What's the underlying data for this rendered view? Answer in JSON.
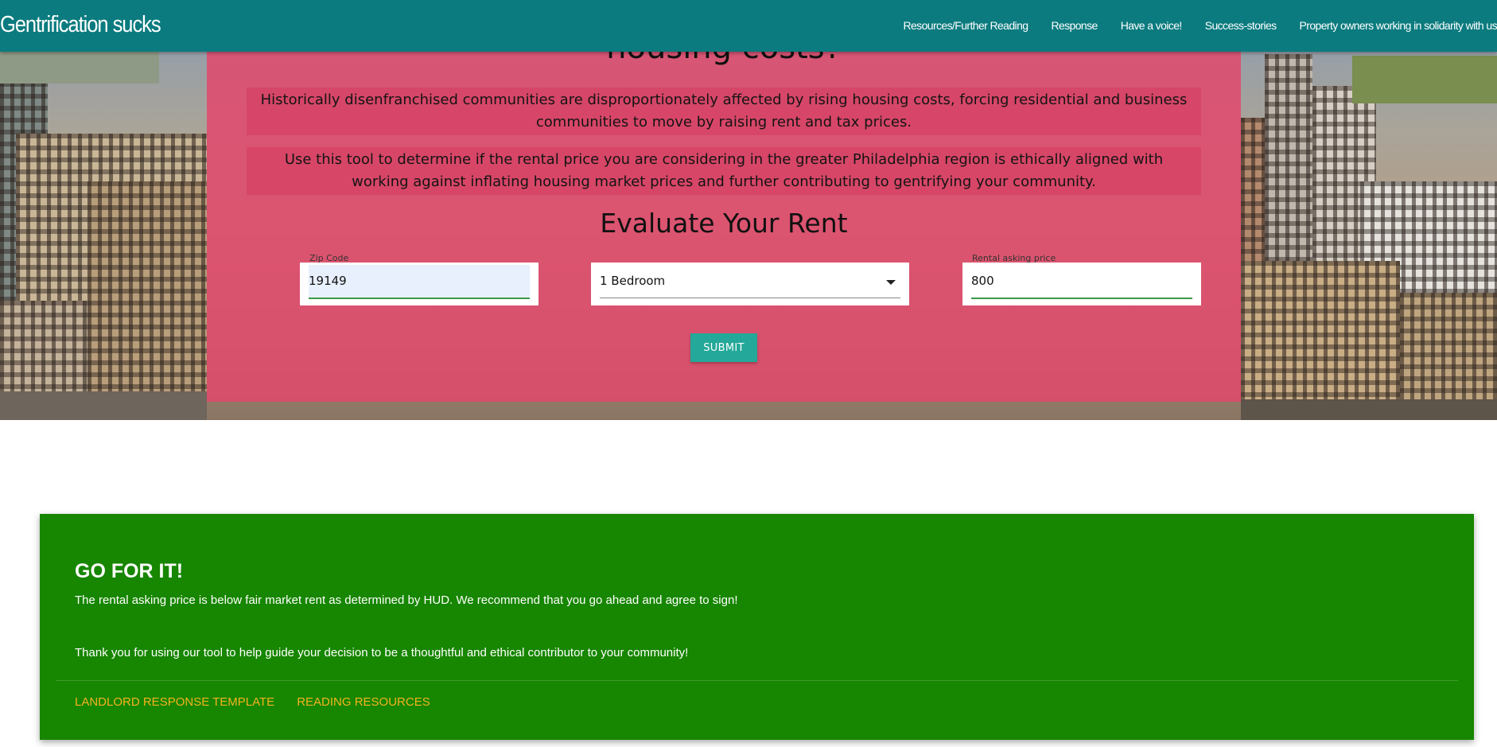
{
  "navbar": {
    "brand": "Gentrification sucks",
    "links": [
      "Resources/Further Reading",
      "Response",
      "Have a voice!",
      "Success-stories",
      "Property owners working in solidarity with us"
    ]
  },
  "hero": {
    "partial_title": "housing costs?",
    "description_1": "Historically disenfranchised communities are disproportionately affected by rising housing costs, forcing residential and business communities to move by raising rent and tax prices.",
    "description_2": "Use this tool to determine if the rental price you are considering in the greater Philadelphia region is ethically aligned with working against inflating housing market prices and further contributing to gentrifying your community.",
    "form_title": "Evaluate Your Rent",
    "zip_label": "Zip Code",
    "zip_value": "19149",
    "bedroom_value": "1 Bedroom",
    "price_label": "Rental asking price",
    "price_value": "800",
    "submit_label": "SUBMIT"
  },
  "result": {
    "title": "GO FOR IT!",
    "message": "The rental asking price is below fair market rent as determined by HUD. We recommend that you go ahead and agree to sign!",
    "thanks": "Thank you for using our tool to help guide your decision to be a thoughtful and ethical contributor to your community!",
    "links": [
      "LANDLORD RESPONSE TEMPLATE",
      "READING RESOURCES"
    ]
  },
  "colors": {
    "navbar": "#0b7b7f",
    "overlay": "#e2486c",
    "submit": "#23a899",
    "result_bg": "#178600",
    "result_link": "#f3b21f"
  }
}
